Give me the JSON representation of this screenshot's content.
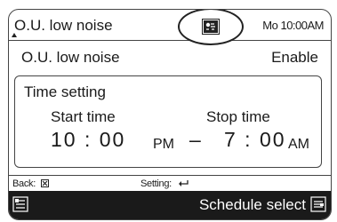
{
  "header": {
    "title": "O.U. low noise",
    "mode_icon": "low-noise-mode-icon",
    "clock": "Mo 10:00AM"
  },
  "setting": {
    "label": "O.U. low noise",
    "value": "Enable"
  },
  "time_setting": {
    "title": "Time setting",
    "start_label": "Start time",
    "stop_label": "Stop time",
    "start_time": "10 : 00",
    "start_ampm": "PM",
    "separator": "–",
    "stop_time": "7 : 00",
    "stop_ampm": "AM"
  },
  "footer": {
    "back_label": "Back:",
    "back_icon": "back-button-icon",
    "setting_label": "Setting:",
    "setting_icon": "enter-arrow-icon"
  },
  "bottom_bar": {
    "menu_icon": "menu-icon",
    "schedule_label": "Schedule select",
    "schedule_icon": "schedule-icon"
  }
}
